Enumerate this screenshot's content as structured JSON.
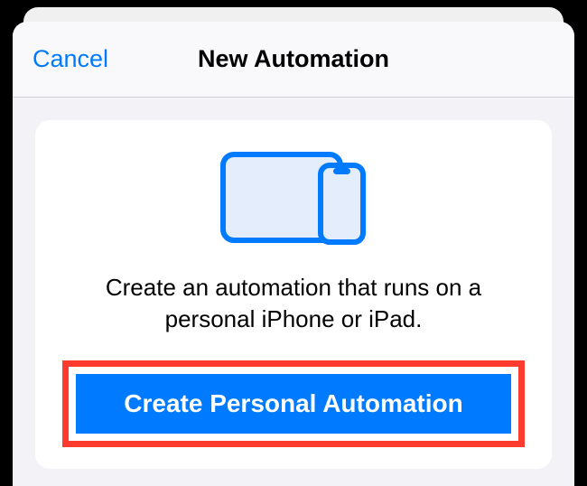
{
  "header": {
    "cancel_label": "Cancel",
    "title": "New Automation"
  },
  "card": {
    "description": "Create an automation that runs on a personal iPhone or iPad.",
    "button_label": "Create Personal Automation"
  },
  "icon": {
    "name": "devices-icon",
    "stroke_color": "#007aff",
    "fill_color": "#e3edfb"
  }
}
